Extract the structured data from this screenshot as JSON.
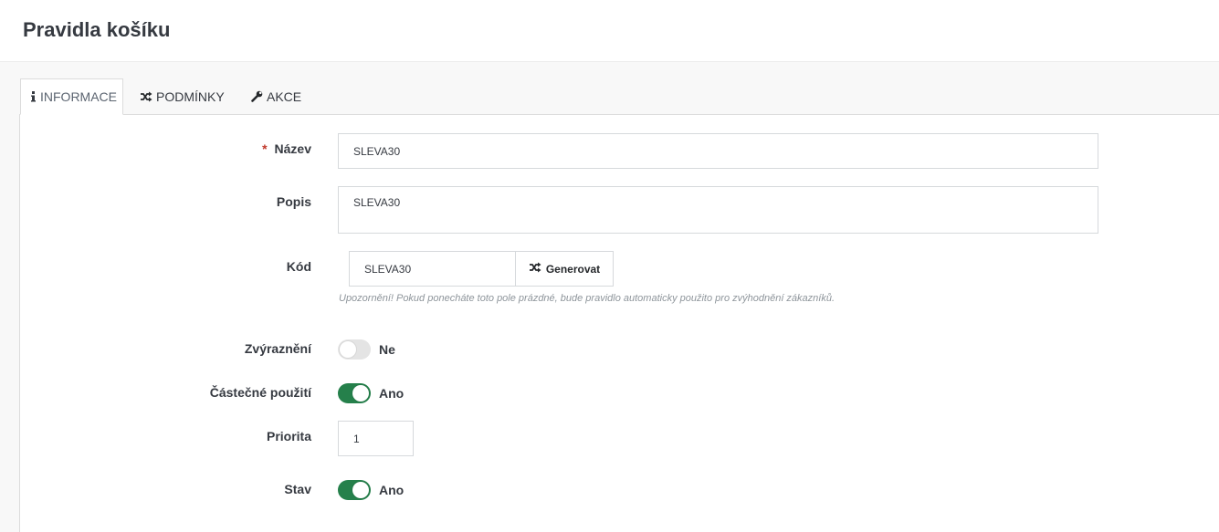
{
  "page": {
    "title": "Pravidla košíku"
  },
  "tabs": [
    {
      "label": "INFORMACE",
      "icon": "info-icon",
      "active": true
    },
    {
      "label": "PODMÍNKY",
      "icon": "shuffle-icon",
      "active": false
    },
    {
      "label": "AKCE",
      "icon": "wrench-icon",
      "active": false
    }
  ],
  "form": {
    "name": {
      "label": "Název",
      "value": "SLEVA30",
      "required_mark": "*"
    },
    "description": {
      "label": "Popis",
      "value": "SLEVA30"
    },
    "code": {
      "label": "Kód",
      "value": "SLEVA30",
      "generate_button": "Generovat",
      "help": "Upozornění! Pokud ponecháte toto pole prázdné, bude pravidlo automaticky použito pro zvýhodnění zákazníků."
    },
    "highlight": {
      "label": "Zvýraznění",
      "state": false,
      "state_text": "Ne"
    },
    "partial_use": {
      "label": "Částečné použití",
      "state": true,
      "state_text": "Ano"
    },
    "priority": {
      "label": "Priorita",
      "value": "1"
    },
    "status": {
      "label": "Stav",
      "state": true,
      "state_text": "Ano"
    }
  },
  "colors": {
    "accent_green": "#25804b",
    "required_red": "#c0392b"
  }
}
